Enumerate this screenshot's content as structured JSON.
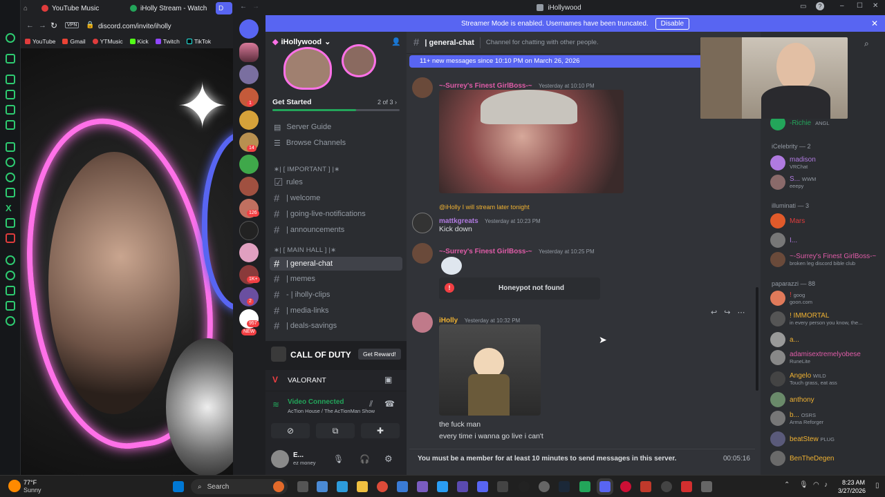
{
  "browser": {
    "tabs": [
      "YouTube Music",
      "iHolly Stream - Watch",
      "D"
    ],
    "url": "discord.com/invite/iholly",
    "vpn_label": "VPN",
    "bookmarks": [
      "YouTube",
      "Gmail",
      "YTMusic",
      "Kick",
      "Twitch",
      "TikTok"
    ]
  },
  "discord": {
    "window_title": "iHollywood",
    "streamer_banner": {
      "text": "Streamer Mode is enabled. Usernames have been truncated.",
      "button": "Disable"
    },
    "guild_badges": [
      "1",
      "14",
      "126",
      "1K+",
      "2",
      "957",
      "NEW"
    ],
    "server": {
      "name": "iHollywood",
      "get_started": "Get Started",
      "progress_text": "2 of 3",
      "progress": 0.66,
      "server_guide": "Server Guide",
      "browse_channels": "Browse Channels",
      "cat_important": "∗| [ IMPORTANT ] |∗",
      "cat_main": "∗| [ MAIN HALL ] |∗",
      "channels_important": [
        "rules",
        "| welcome",
        "| going-live-notifications",
        "| announcements"
      ],
      "channels_main": [
        "| general-chat",
        "| memes",
        "- | iholly-clips",
        "| media-links",
        "| deals-savings"
      ],
      "promo": {
        "game": "CALL OF DUTY",
        "button": "Get Reward!"
      },
      "activity": "VALORANT",
      "voice": {
        "status": "Video Connected",
        "where": "AcTion House / The AcTionMan Show"
      },
      "user": {
        "name": "E...",
        "status": "ez money"
      }
    },
    "chat": {
      "channel": "| general-chat",
      "topic": "Channel for chatting with other people.",
      "new_messages": "11+ new messages since 10:10 PM on March 26, 2026",
      "messages": [
        {
          "author": "~-Surrey's Finest GirlBoss-~",
          "time": "Yesterday at 10:10 PM"
        },
        {
          "reply": "@iHolly I will stream later tonight",
          "author": "mattkgreats",
          "time": "Yesterday at 10:23 PM",
          "text": "Kick down"
        },
        {
          "author": "~-Surrey's Finest GirlBoss-~",
          "time": "Yesterday at 10:25 PM",
          "embed": "Honeypot not found"
        },
        {
          "author": "iHolly",
          "time": "Yesterday at 10:32 PM",
          "lines": [
            "the fuck man",
            "every time i wanna go live i can't"
          ]
        }
      ],
      "input_notice": "You must be a member for at least 10 minutes to send messages in this server.",
      "timer": "00:05:16"
    },
    "members": {
      "top": {
        "name": "-Richie",
        "tag": "ANGL"
      },
      "groups": [
        {
          "title": "iCelebrity — 2",
          "people": [
            {
              "name": "madison",
              "sub": "VRChat",
              "color": "#b07ae0"
            },
            {
              "name": "S...",
              "sub": "eeepy",
              "tag": "WWM",
              "color": "#b07ae0"
            }
          ]
        },
        {
          "title": "illuminati — 3",
          "people": [
            {
              "name": "Mars",
              "sub": "",
              "color": "#e03c3c"
            },
            {
              "name": "I...",
              "sub": "",
              "color": "#b07ae0"
            },
            {
              "name": "~-Surrey's Finest GirlBoss-~",
              "sub": "broken leg discord bible club",
              "color": "#e05ca8"
            }
          ]
        },
        {
          "title": "paparazzi — 88",
          "people": [
            {
              "name": "!",
              "tag": "goog",
              "sub": "goon.com",
              "color": "#e03c3c"
            },
            {
              "name": "! IMMORTAL",
              "sub": "in every person you know, the...",
              "color": "#f0b232"
            },
            {
              "name": "a...",
              "sub": "",
              "color": "#f0b232"
            },
            {
              "name": "adamisextremelyobese",
              "sub": "RuneLite",
              "color": "#e05ca8"
            },
            {
              "name": "Angelo",
              "tag": "WILD",
              "sub": "Touch grass, eat ass",
              "color": "#f0b232"
            },
            {
              "name": "anthony",
              "sub": "",
              "color": "#f0b232"
            },
            {
              "name": "b...",
              "tag": "OSRS",
              "sub": "Arma Reforger",
              "color": "#f0b232"
            },
            {
              "name": "beatStew",
              "tag": "PLUG",
              "sub": "",
              "color": "#f0b232"
            },
            {
              "name": "BenTheDegen",
              "sub": "",
              "color": "#f0b232"
            }
          ]
        }
      ]
    }
  },
  "taskbar": {
    "weather_temp": "77°F",
    "weather_desc": "Sunny",
    "search": "Search",
    "time": "8:23 AM",
    "date": "3/27/2026"
  },
  "colors": {
    "blurple": "#5865f2",
    "green": "#23a55a",
    "pink": "#e05ca8"
  }
}
